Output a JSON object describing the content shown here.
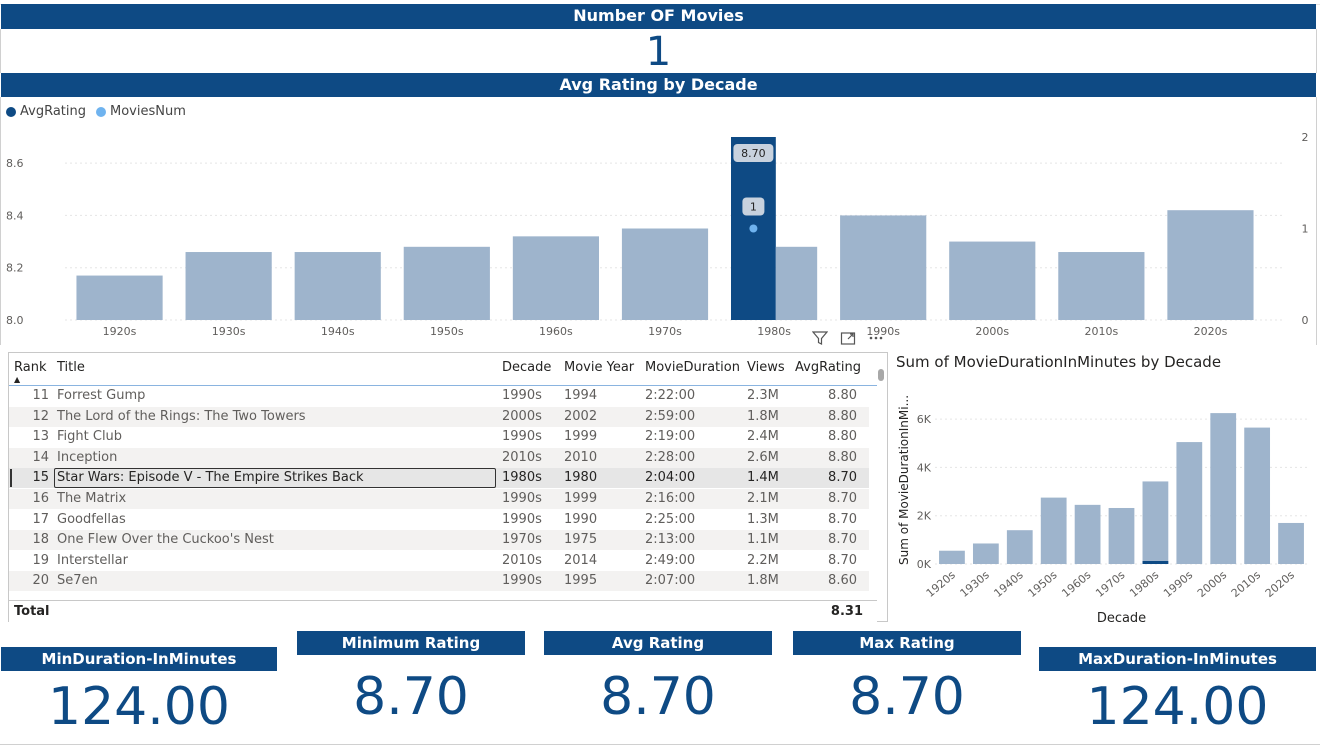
{
  "header": {
    "number_of_movies_title": "Number OF Movies",
    "number_of_movies_value": "1",
    "avg_rating_title": "Avg Rating by Decade"
  },
  "legend": [
    {
      "name": "AvgRating",
      "color": "#0e4a84"
    },
    {
      "name": "MoviesNum",
      "color": "#6fb3ef"
    }
  ],
  "chart_data": [
    {
      "type": "bar",
      "title": "Avg Rating by Decade",
      "categories": [
        "1920s",
        "1930s",
        "1940s",
        "1950s",
        "1960s",
        "1970s",
        "1980s",
        "1990s",
        "2000s",
        "2010s",
        "2020s"
      ],
      "series": [
        {
          "name": "AvgRating",
          "values": [
            8.17,
            8.26,
            8.26,
            8.28,
            8.32,
            8.35,
            8.7,
            8.4,
            8.3,
            8.26,
            8.42
          ],
          "highlight": [
            8.7,
            "1980s"
          ]
        },
        {
          "name": "MoviesNum",
          "values": [
            null,
            null,
            null,
            null,
            null,
            null,
            1,
            null,
            null,
            null,
            null
          ]
        }
      ],
      "ylim_left": [
        8.0,
        8.7
      ],
      "yticks_left": [
        "8.0",
        "8.2",
        "8.4",
        "8.6"
      ],
      "ylim_right": [
        0,
        2.0
      ],
      "yticks_right": [
        "0",
        "1",
        "2"
      ],
      "selected_category": "1980s",
      "selected_bar_label": "8.70",
      "selected_point_label": "1",
      "grid": true
    },
    {
      "type": "bar",
      "title": "Sum of MovieDurationInMinutes by Decade",
      "xlabel": "Decade",
      "ylabel": "Sum of MovieDurationInMi...",
      "categories": [
        "1920s",
        "1930s",
        "1940s",
        "1950s",
        "1960s",
        "1970s",
        "1980s",
        "1990s",
        "2000s",
        "2010s",
        "2020s"
      ],
      "values": [
        550,
        850,
        1400,
        2750,
        2450,
        2320,
        3420,
        5050,
        6250,
        5650,
        1700
      ],
      "highlight_values": [
        0,
        0,
        0,
        0,
        0,
        0,
        124,
        0,
        0,
        0,
        0
      ],
      "ylim": [
        0,
        7000
      ],
      "yticks": [
        "0K",
        "2K",
        "4K",
        "6K"
      ],
      "grid": true
    }
  ],
  "table": {
    "columns": [
      "Rank",
      "Title",
      "Decade",
      "Movie Year",
      "MovieDuration",
      "Views",
      "AvgRating"
    ],
    "rows": [
      [
        "11",
        "Forrest Gump",
        "1990s",
        "1994",
        "2:22:00",
        "2.3M",
        "8.80"
      ],
      [
        "12",
        "The Lord of the Rings: The Two Towers",
        "2000s",
        "2002",
        "2:59:00",
        "1.8M",
        "8.80"
      ],
      [
        "13",
        "Fight Club",
        "1990s",
        "1999",
        "2:19:00",
        "2.4M",
        "8.80"
      ],
      [
        "14",
        "Inception",
        "2010s",
        "2010",
        "2:28:00",
        "2.6M",
        "8.80"
      ],
      [
        "15",
        "Star Wars: Episode V - The Empire Strikes Back",
        "1980s",
        "1980",
        "2:04:00",
        "1.4M",
        "8.70"
      ],
      [
        "16",
        "The Matrix",
        "1990s",
        "1999",
        "2:16:00",
        "2.1M",
        "8.70"
      ],
      [
        "17",
        "Goodfellas",
        "1990s",
        "1990",
        "2:25:00",
        "1.3M",
        "8.70"
      ],
      [
        "18",
        "One Flew Over the Cuckoo's Nest",
        "1970s",
        "1975",
        "2:13:00",
        "1.1M",
        "8.70"
      ],
      [
        "19",
        "Interstellar",
        "2010s",
        "2014",
        "2:49:00",
        "2.2M",
        "8.70"
      ],
      [
        "20",
        "Se7en",
        "1990s",
        "1995",
        "2:07:00",
        "1.8M",
        "8.60"
      ]
    ],
    "selected_row": 4,
    "total_label": "Total",
    "total_value": "8.31"
  },
  "cards": [
    {
      "id": "min-duration",
      "title": "MinDuration-InMinutes",
      "value": "124.00"
    },
    {
      "id": "min-rating",
      "title": "Minimum Rating",
      "value": "8.70"
    },
    {
      "id": "avg-rating",
      "title": "Avg Rating",
      "value": "8.70"
    },
    {
      "id": "max-rating",
      "title": "Max Rating",
      "value": "8.70"
    },
    {
      "id": "max-duration",
      "title": "MaxDuration-InMinutes",
      "value": "124.00"
    }
  ],
  "icons": [
    "filter-icon",
    "focus-mode-icon",
    "more-options-icon"
  ],
  "colors": {
    "accent": "#0e4a84",
    "bar": "#9eb4cc",
    "point": "#6fb3ef"
  }
}
